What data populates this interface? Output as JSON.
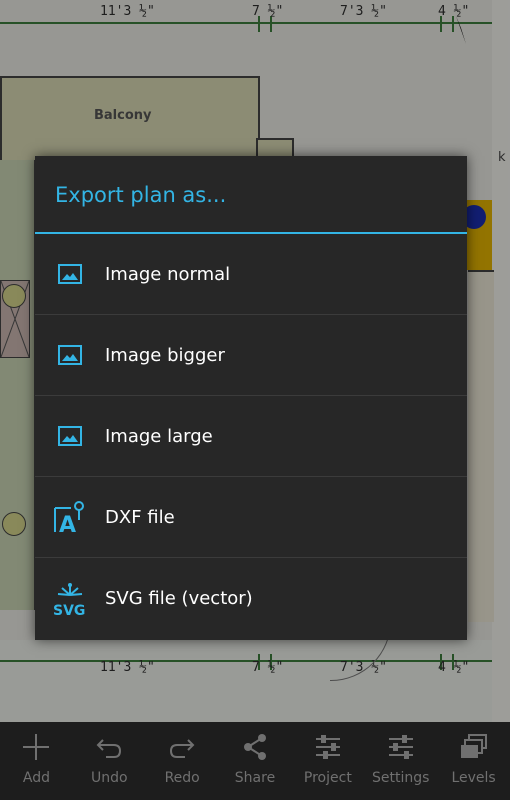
{
  "plan": {
    "top_dims": [
      "11'3 ½\"",
      "7 ½\"",
      "7'3 ½\"",
      "4 ½\""
    ],
    "bottom_dims": [
      "11'3 ½\"",
      "7 ½\"",
      "7'3 ½\"",
      "4 ½\""
    ],
    "room_label": "Balcony",
    "edge_text": "k"
  },
  "dialog": {
    "title": "Export plan as...",
    "items": [
      {
        "label": "Image normal",
        "icon": "image-icon"
      },
      {
        "label": "Image bigger",
        "icon": "image-icon"
      },
      {
        "label": "Image large",
        "icon": "image-icon"
      },
      {
        "label": "DXF file",
        "icon": "dxf-icon",
        "icon_text": "A"
      },
      {
        "label": "SVG file (vector)",
        "icon": "svg-icon",
        "icon_text": "SVG"
      }
    ]
  },
  "toolbar": {
    "items": [
      {
        "label": "Add",
        "icon": "plus-icon"
      },
      {
        "label": "Undo",
        "icon": "undo-icon"
      },
      {
        "label": "Redo",
        "icon": "redo-icon"
      },
      {
        "label": "Share",
        "icon": "share-icon"
      },
      {
        "label": "Project",
        "icon": "sliders-icon"
      },
      {
        "label": "Settings",
        "icon": "sliders-icon"
      },
      {
        "label": "Levels",
        "icon": "layers-icon"
      }
    ]
  },
  "colors": {
    "accent": "#33b5e5",
    "dialog_bg": "#272727",
    "toolbar_bg": "#1d1d1d",
    "toolbar_text": "#707070"
  }
}
